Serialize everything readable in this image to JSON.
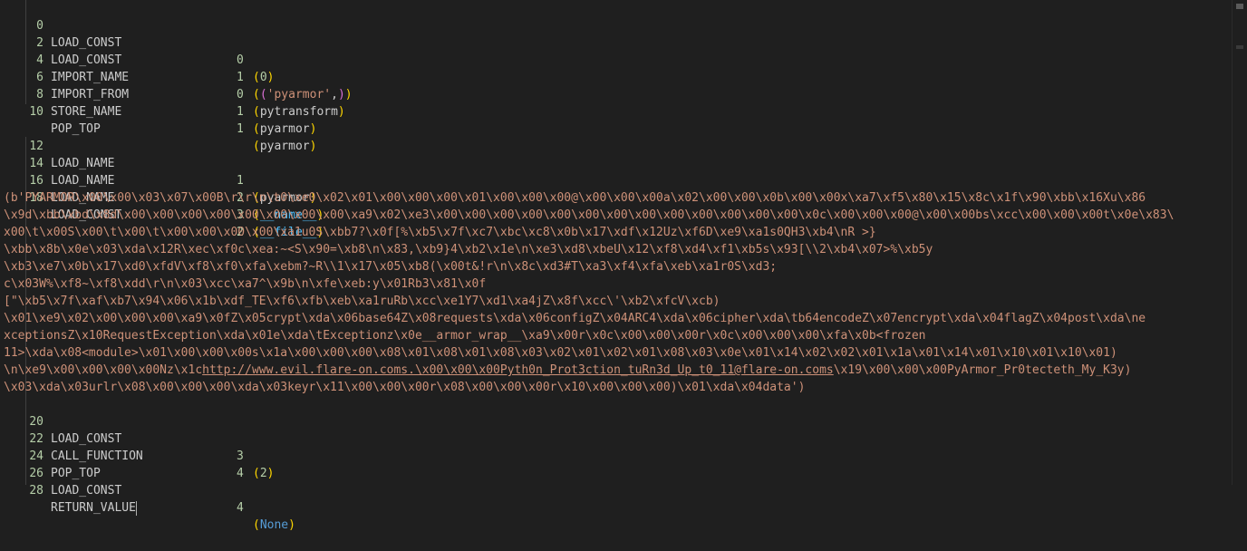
{
  "lines": [
    {
      "n": "0",
      "op": "LOAD_CONST",
      "arg": "0",
      "val": "(0)"
    },
    {
      "n": "2",
      "op": "LOAD_CONST",
      "arg": "1",
      "val": "(('pyarmor',))"
    },
    {
      "n": "4",
      "op": "IMPORT_NAME",
      "arg": "0",
      "val": "(pytransform)"
    },
    {
      "n": "6",
      "op": "IMPORT_FROM",
      "arg": "1",
      "val": "(pyarmor)"
    },
    {
      "n": "8",
      "op": "STORE_NAME",
      "arg": "1",
      "val": "(pyarmor)"
    },
    {
      "n": "10",
      "op": "POP_TOP",
      "arg": "",
      "val": ""
    },
    {
      "n": "12",
      "op": "LOAD_NAME",
      "arg": "1",
      "val": "(pyarmor)"
    },
    {
      "n": "14",
      "op": "LOAD_NAME",
      "arg": "2",
      "val": "(__name__)"
    },
    {
      "n": "16",
      "op": "LOAD_NAME",
      "arg": "3",
      "val": "(__file__)"
    },
    {
      "n": "18",
      "op": "LOAD_CONST",
      "arg": "2",
      "val": ""
    },
    {
      "n": "20",
      "op": "LOAD_CONST",
      "arg": "3",
      "val": "(2)"
    },
    {
      "n": "22",
      "op": "CALL_FUNCTION",
      "arg": "4",
      "val": ""
    },
    {
      "n": "24",
      "op": "POP_TOP",
      "arg": "",
      "val": ""
    },
    {
      "n": "26",
      "op": "LOAD_CONST",
      "arg": "4",
      "val": "(None)"
    },
    {
      "n": "28",
      "op": "RETURN_VALUE",
      "arg": "",
      "val": ""
    }
  ],
  "bytes_const": [
    "(b'PYARMOR\\x00\\x00\\x03\\x07\\x00B\\r\\r\\n\\t0\\xe0\\x02\\x01\\x00\\x00\\x00\\x01\\x00\\x00\\x00@\\x00\\x00\\x00a\\x02\\x00\\x00\\x0b\\x00\\x00x\\xa7\\xf5\\x80\\x15\\x8c\\x1f\\x90\\xbb\\x16Xu\\x86",
    "\\x9d\\xbb\\xbd\\x8d\\x00\\x00\\x00\\x00\\x00\\x00\\x00\\x00\\xa9\\x02\\xe3\\x00\\x00\\x00\\x00\\x00\\x00\\x00\\x00\\x00\\x00\\x00\\x00\\x00\\x0c\\x00\\x00\\x00@\\x00\\x00bs\\xcc\\x00\\x00\\x00t\\x0e\\x83\\",
    "x00\\t\\x00S\\x00\\t\\x00\\t\\x00\\x00\\x00\\x00\\xa1u0S\\xbb7?\\x0f[%\\xb5\\x7f\\xc7\\xbc\\xc8\\x0b\\x17\\xdf\\x12Uz\\xf6D\\xe9\\xa1s0QH3\\xb4\\nR >}",
    "\\xbb\\x8b\\x0e\\x03\\xda\\x12R\\xec\\xf0c\\xea:~<S\\x90=\\xb8\\n\\x83,\\xb9}4\\xb2\\x1e\\n\\xe3\\xd8\\xbeU\\x12\\xf8\\xd4\\xf1\\xb5s\\x93[\\\\2\\xb4\\x07>%\\xb5y",
    "\\xb3\\xe7\\x0b\\x17\\xd0\\xfdV\\xf8\\xf0\\xfa\\xebm?~R\\\\1\\x17\\x05\\xb8(\\x00t&!r\\n\\x8c\\xd3#T\\xa3\\xf4\\xfa\\xeb\\xa1r0S\\xd3;",
    "c\\x03W%\\xf8~\\xf8\\xdd\\r\\n\\x03\\xcc\\xa7^\\x9b\\n\\xfe\\xeb:y\\x01Rb3\\x81\\x0f",
    "[\"\\xb5\\x7f\\xaf\\xb7\\x94\\x06\\x1b\\xdf_TE\\xf6\\xfb\\xeb\\xa1ruRb\\xcc\\xe1Y7\\xd1\\xa4jZ\\x8f\\xcc\\'\\xb2\\xfcV\\xcb)",
    "\\x01\\xe9\\x02\\x00\\x00\\x00\\xa9\\x0fZ\\x05crypt\\xda\\x06base64Z\\x08requests\\xda\\x06configZ\\x04ARC4\\xda\\x06cipher\\xda\\tb64encodeZ\\x07encrypt\\xda\\x04flagZ\\x04post\\xda\\ne",
    "xceptionsZ\\x10RequestException\\xda\\x01e\\xda\\tExceptionz\\x0e__armor_wrap__\\xa9\\x00r\\x0c\\x00\\x00\\x00r\\x0c\\x00\\x00\\x00\\xfa\\x0b<frozen",
    "11>\\xda\\x08<module>\\x01\\x00\\x00\\x00s\\x1a\\x00\\x00\\x00\\x08\\x01\\x08\\x01\\x08\\x03\\x02\\x01\\x02\\x01\\x08\\x03\\x0e\\x01\\x14\\x02\\x02\\x01\\x1a\\x01\\x14\\x01\\x10\\x01\\x10\\x01)",
    "\\n\\xe9\\x00\\x00\\x00\\x00Nz\\x1c",
    "\\x03\\xda\\x03urlr\\x08\\x00\\x00\\x00\\xda\\x03keyr\\x11\\x00\\x00\\x00r\\x08\\x00\\x00\\x00r\\x10\\x00\\x00\\x00)\\x01\\xda\\x04data')"
  ],
  "url_line_link": "http://www.evil.flare-on.coms.\\x00\\x00\\x00Pyth0n_Prot3ction_tuRn3d_Up_t0_11@flare-on.coms",
  "url_line_tail": "\\x19\\x00\\x00\\x00PyArmor_Pr0tecteth_My_K3y)"
}
